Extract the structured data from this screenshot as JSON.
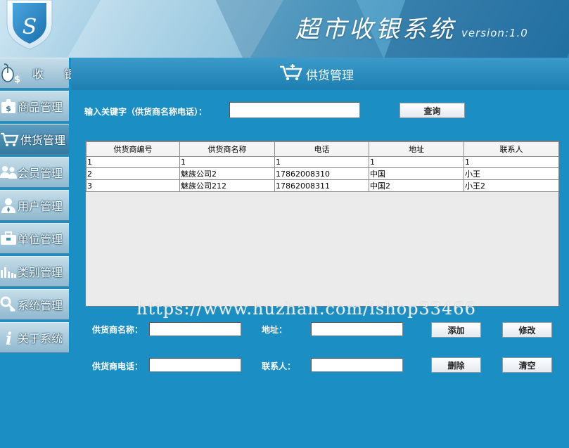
{
  "app": {
    "title": "超市收银系统",
    "version": "version:1.0",
    "logo_letter": "S"
  },
  "sidebar": {
    "items": [
      {
        "label": "收 银",
        "icon": "cashier-mouse-icon"
      },
      {
        "label": "商品管理",
        "icon": "money-bag-icon"
      },
      {
        "label": "供货管理",
        "icon": "cart-icon",
        "active": true
      },
      {
        "label": "会员管理",
        "icon": "members-icon"
      },
      {
        "label": "用户管理",
        "icon": "user-icon"
      },
      {
        "label": "单位管理",
        "icon": "briefcase-icon"
      },
      {
        "label": "类别管理",
        "icon": "bar-chart-icon"
      },
      {
        "label": "系统管理",
        "icon": "tools-icon"
      },
      {
        "label": "关于系统",
        "icon": "info-icon"
      }
    ]
  },
  "panel": {
    "title": "供货管理",
    "search": {
      "label": "输入关键字（供货商名称电话）：",
      "value": "",
      "button": "查询"
    },
    "table": {
      "columns": [
        "供货商编号",
        "供货商名称",
        "电话",
        "地址",
        "联系人"
      ],
      "rows": [
        [
          "1",
          "1",
          "1",
          "1",
          "1"
        ],
        [
          "2",
          "魅族公司2",
          "17862008310",
          "中国",
          "小王"
        ],
        [
          "3",
          "魅族公司212",
          "17862008311",
          "中国2",
          "小王2"
        ]
      ]
    },
    "watermark": "https://www.huzhan.com/ishop33466",
    "form": {
      "name_label": "供货商名称：",
      "name_value": "",
      "address_label": "地址：",
      "address_value": "",
      "phone_label": "供货商电话：",
      "phone_value": "",
      "contact_label": "联系人：",
      "contact_value": "",
      "add_button": "添加",
      "edit_button": "修改",
      "delete_button": "删除",
      "clear_button": "清空"
    }
  },
  "colors": {
    "background": "#1b8fc4",
    "header_bar": "#2a8dbf",
    "nav_active": "#3f86ad"
  }
}
